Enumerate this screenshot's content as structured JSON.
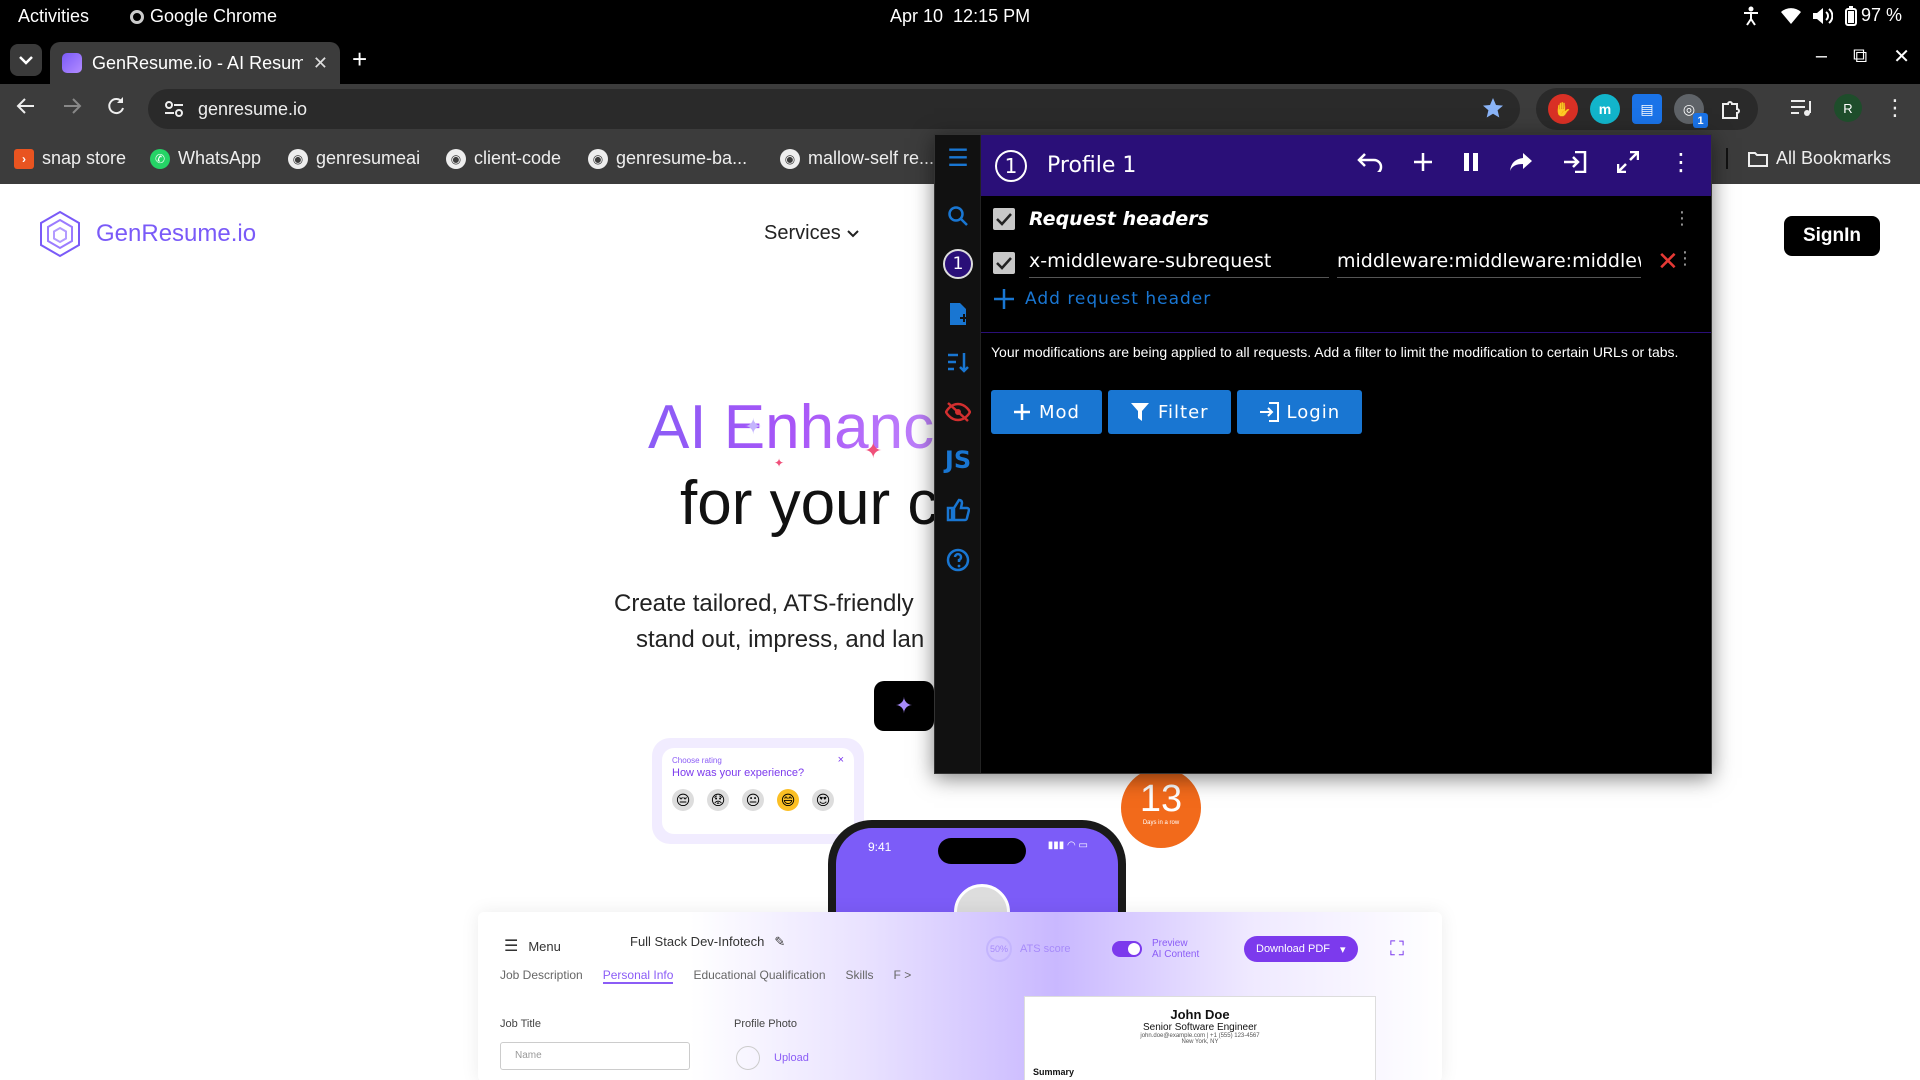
{
  "system": {
    "activities": "Activities",
    "app_name": "Google Chrome",
    "date": "Apr 10",
    "time": "12:15 PM",
    "battery": "97 %"
  },
  "browser": {
    "tab_title": "GenResume.io - AI Resum",
    "url": "genresume.io",
    "profile_initial": "R",
    "extension_badge": "1",
    "bookmarks": [
      "snap store",
      "WhatsApp",
      "genresumeai",
      "client-code",
      "genresume-ba...",
      "mallow-self re..."
    ],
    "all_bookmarks": "All Bookmarks"
  },
  "page": {
    "logo_text": "GenResume.io",
    "nav_services": "Services",
    "signin": "SignIn",
    "hero_line1": "AI Enhanc",
    "hero_line2": "for your c",
    "sub_line1": "Create tailored, ATS-friendly",
    "sub_line2": "stand out, impress, and lan",
    "rating": {
      "small": "Choose rating",
      "question": "How was your experience?",
      "close": "×"
    },
    "streak": {
      "number": "13",
      "label": "Days in a row"
    },
    "phone_time": "9:41",
    "app": {
      "menu": "Menu",
      "job_name": "Full Stack Dev-Infotech",
      "tabs": [
        "Job Description",
        "Personal Info",
        "Educational Qualification",
        "Skills",
        "F >"
      ],
      "active_tab": 1,
      "job_title_label": "Job Title",
      "profile_photo_label": "Profile Photo",
      "name_placeholder": "Name",
      "upload": "Upload",
      "ats_percent": "50%",
      "ats_label": "ATS score",
      "preview_line1": "Preview",
      "preview_line2": "AI Content",
      "download_pdf": "Download PDF",
      "resume": {
        "name": "John Doe",
        "role": "Senior Software Engineer",
        "contact": "john.doe@example.com | +1 (555) 123-4567",
        "location": "New York, NY",
        "summary": "Summary"
      }
    }
  },
  "modheader": {
    "profile_number": "1",
    "profile_name": "Profile 1",
    "section_title": "Request headers",
    "header_name": "x-middleware-subrequest",
    "header_value": "middleware:middleware:middleware",
    "add_header": "Add request header",
    "notice": "Your modifications are being applied to all requests. Add a filter to limit the modification to certain URLs or tabs.",
    "btn_mod": "Mod",
    "btn_filter": "Filter",
    "btn_login": "Login",
    "side_js": "JS",
    "accent": "#1976d2",
    "header_bg": "#2a0f78"
  }
}
